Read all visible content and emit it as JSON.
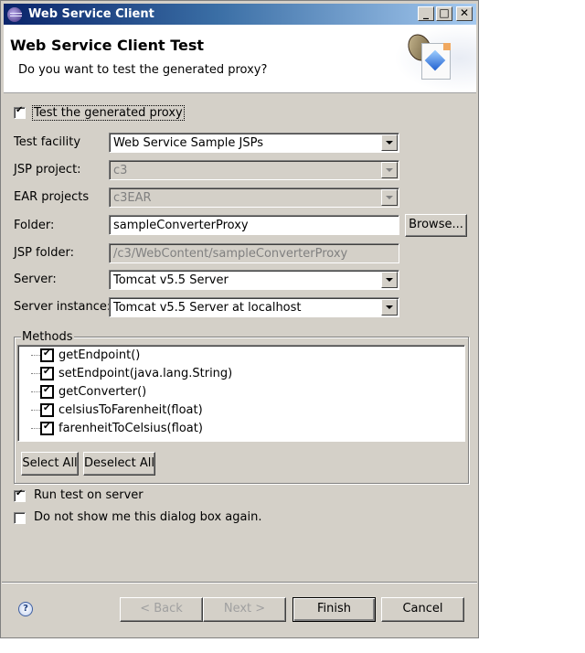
{
  "window": {
    "title": "Web Service Client",
    "controls": {
      "minimize": "_",
      "maximize": "□",
      "close": "✕"
    }
  },
  "header": {
    "title": "Web Service Client Test",
    "message": "Do you want to test the generated proxy?"
  },
  "test_proxy": {
    "label": "Test the generated proxy",
    "checked": true
  },
  "fields": {
    "test_facility": {
      "label": "Test facility",
      "value": "Web Service Sample JSPs"
    },
    "jsp_project": {
      "label": "JSP project:",
      "value": "c3"
    },
    "ear_projects": {
      "label": "EAR projects",
      "value": "c3EAR"
    },
    "folder": {
      "label": "Folder:",
      "value": "sampleConverterProxy",
      "browse_label": "Browse..."
    },
    "jsp_folder": {
      "label": "JSP folder:",
      "value": "/c3/WebContent/sampleConverterProxy"
    },
    "server": {
      "label": "Server:",
      "value": "Tomcat v5.5 Server"
    },
    "server_instance": {
      "label": "Server instance:",
      "value": "Tomcat v5.5 Server at localhost"
    }
  },
  "methods": {
    "label": "Methods",
    "items": [
      {
        "name": "getEndpoint()",
        "checked": true
      },
      {
        "name": "setEndpoint(java.lang.String)",
        "checked": true
      },
      {
        "name": "getConverter()",
        "checked": true
      },
      {
        "name": "celsiusToFarenheit(float)",
        "checked": true
      },
      {
        "name": "farenheitToCelsius(float)",
        "checked": true
      }
    ],
    "select_all_label": "Select All",
    "deselect_all_label": "Deselect All"
  },
  "options": {
    "run_test": {
      "label": "Run test on server",
      "checked": true
    },
    "dont_show": {
      "label": "Do not show me this dialog box again.",
      "checked": false
    }
  },
  "footer": {
    "help_icon": "?",
    "back_label": "< Back",
    "next_label": "Next >",
    "finish_label": "Finish",
    "cancel_label": "Cancel"
  }
}
